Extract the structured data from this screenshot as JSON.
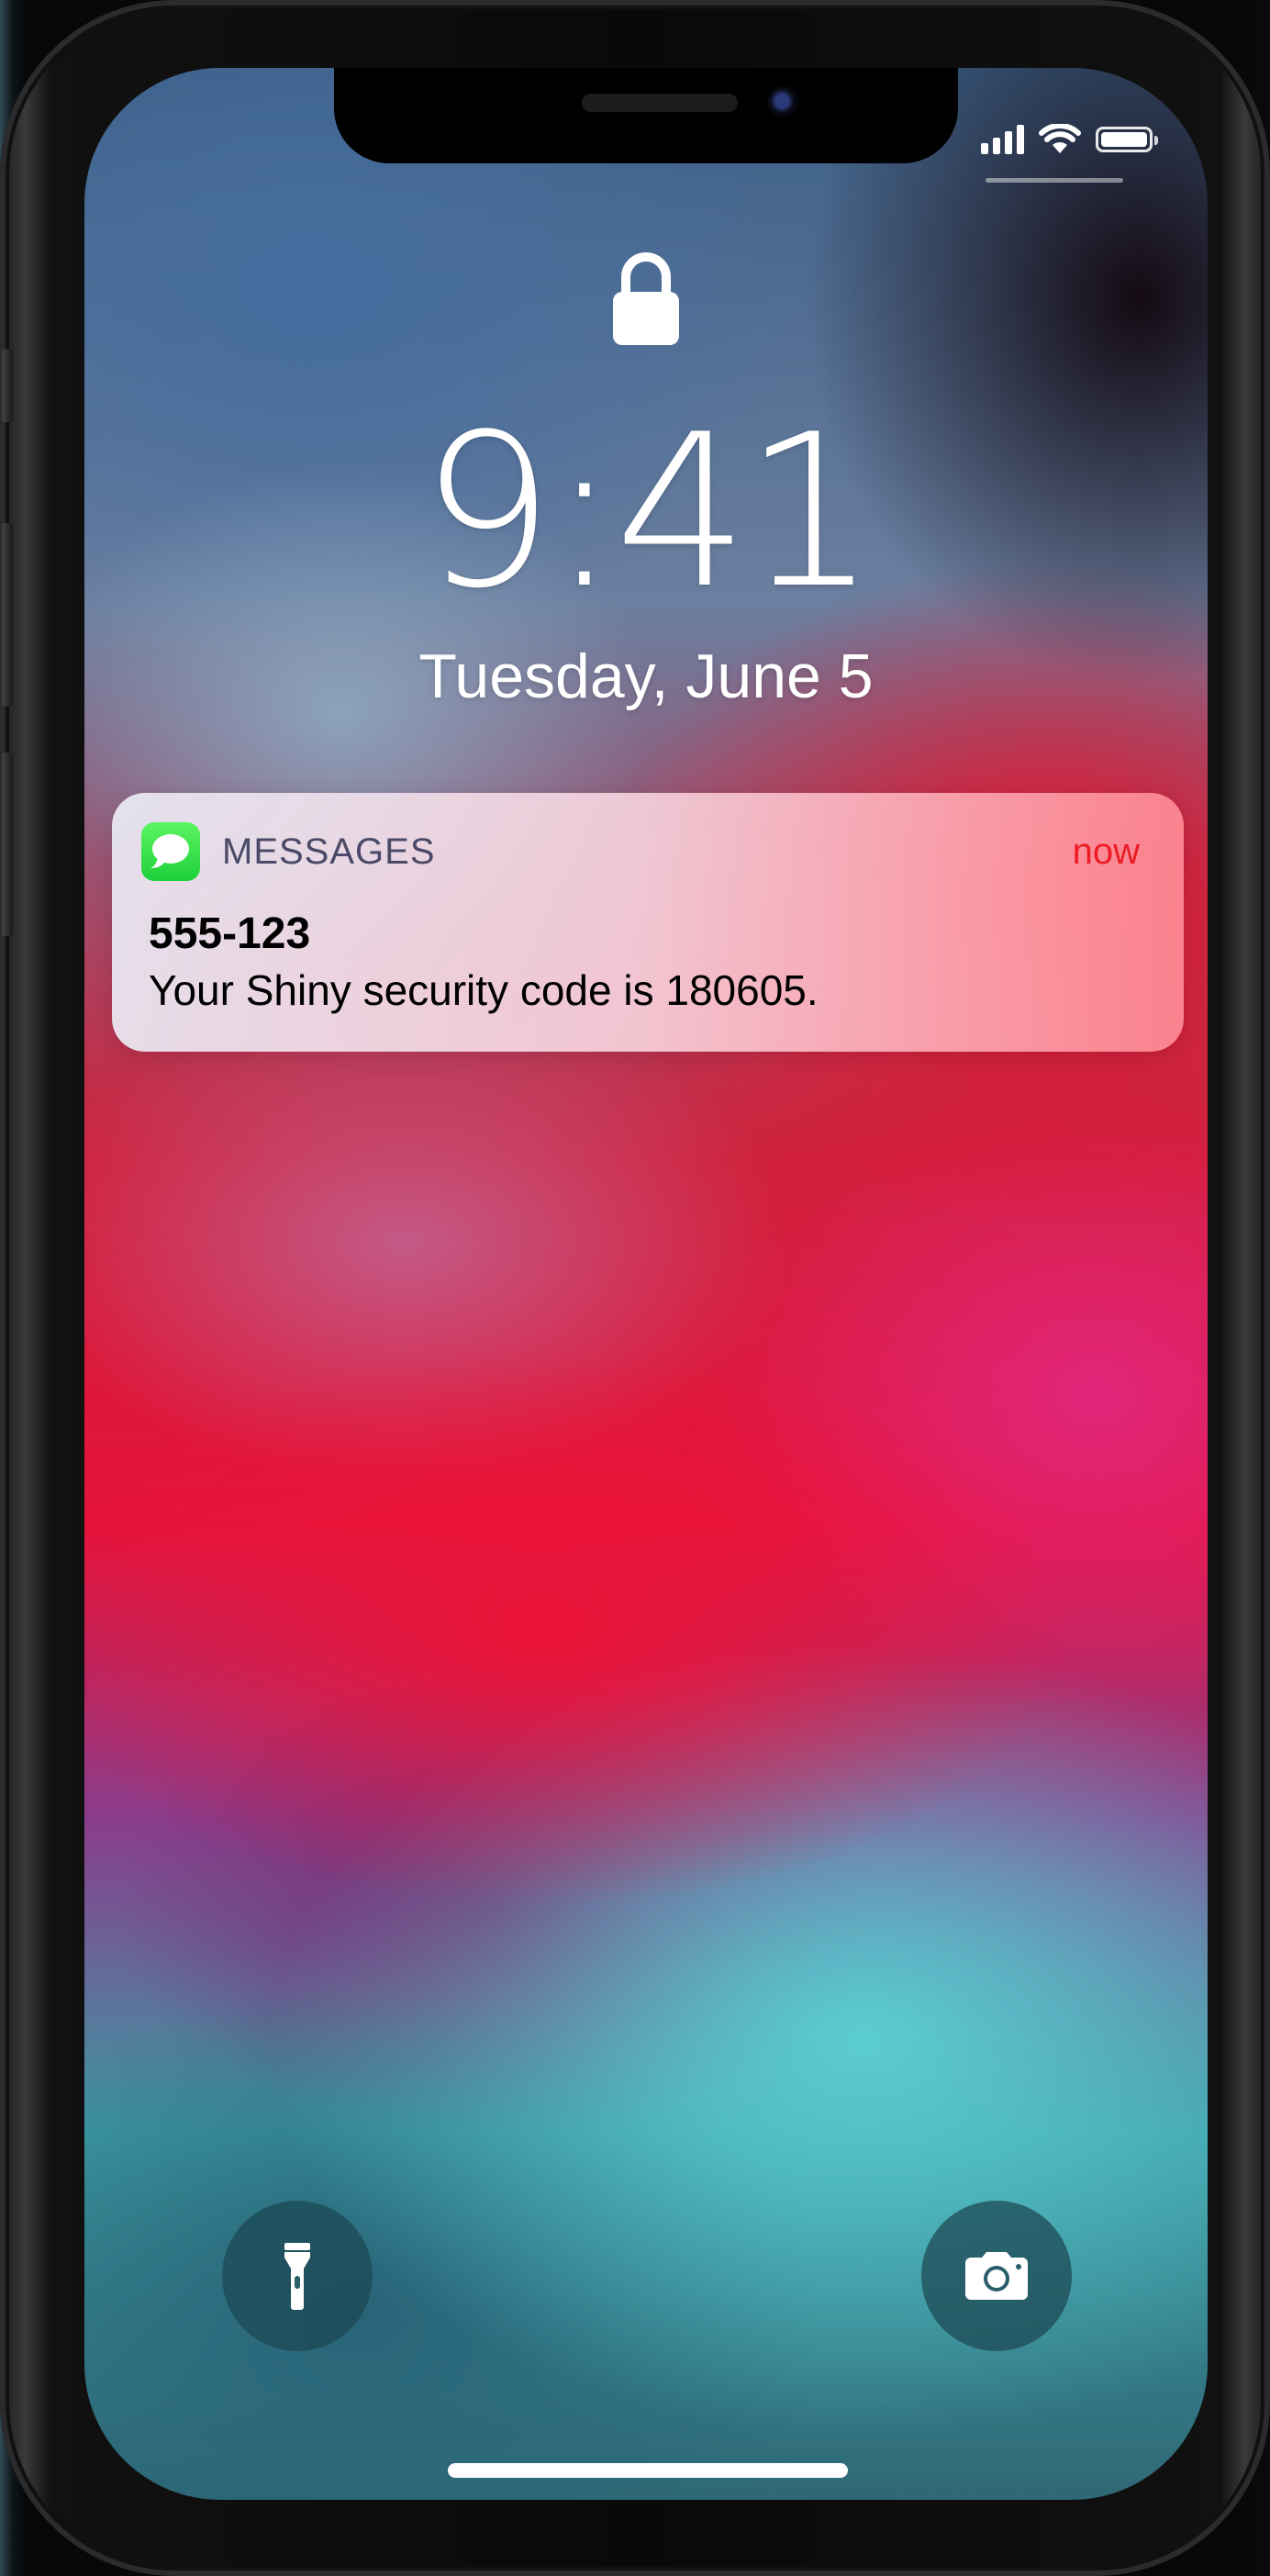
{
  "status_bar": {
    "signal_icon": "cellular-signal-icon",
    "wifi_icon": "wifi-icon",
    "battery_icon": "battery-icon",
    "battery_level": 1.0
  },
  "lock_screen": {
    "lock_icon": "padlock-icon",
    "time": "9:41",
    "date": "Tuesday, June 5"
  },
  "notification": {
    "app_icon": "messages-app-icon",
    "app_name": "MESSAGES",
    "timestamp": "now",
    "title": "555-123",
    "body": "Your Shiny security code is 180605.",
    "accent_color": "#ec1b24",
    "icon_color": "#2fdc49"
  },
  "quick_actions": {
    "left_icon": "flashlight-icon",
    "right_icon": "camera-icon"
  }
}
